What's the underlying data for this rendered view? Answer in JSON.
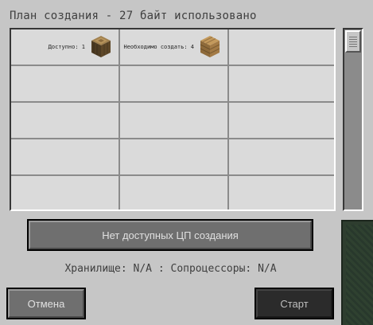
{
  "window": {
    "title": "План создания - 27 байт использовано"
  },
  "grid": {
    "cells": [
      {
        "label": "Доступно: 1",
        "icon": "oak-log-icon"
      },
      {
        "label": "Необходимо создать: 4",
        "icon": "oak-planks-icon"
      },
      {
        "label": "",
        "icon": ""
      }
    ]
  },
  "status_button": {
    "label": "Нет доступных ЦП создания"
  },
  "info": {
    "text": "Хранилище: N/A : Сопроцессоры: N/A"
  },
  "buttons": {
    "cancel": "Отмена",
    "start": "Старт"
  }
}
